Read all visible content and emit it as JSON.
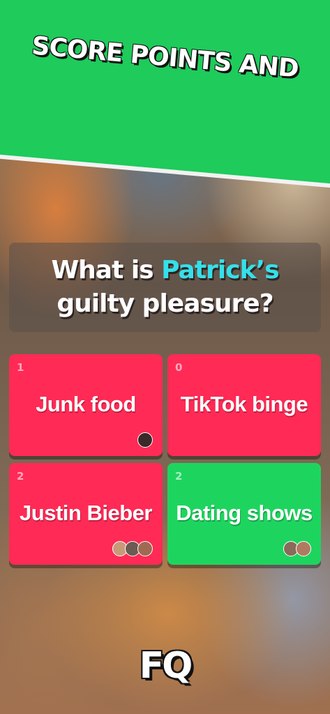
{
  "banner": {
    "headline": "SCORE POINTS AND"
  },
  "question": {
    "prefix": "What is ",
    "name": "Patrick’s",
    "suffix": "guilty pleasure?"
  },
  "answers": [
    {
      "count": "1",
      "label": "Junk food",
      "color": "#ff2a55",
      "avatars": [
        "#3a2a2a"
      ]
    },
    {
      "count": "0",
      "label": "TikTok binge",
      "color": "#ff2a55",
      "avatars": []
    },
    {
      "count": "2",
      "label": "Justin Bieber",
      "color": "#ff2a55",
      "avatars": [
        "#c89a78",
        "#6b5b53",
        "#a06a52"
      ]
    },
    {
      "count": "2",
      "label": "Dating shows",
      "color": "#1dd55e",
      "avatars": [
        "#8a6a5a",
        "#b07a60"
      ]
    }
  ],
  "logo": {
    "text": "FQ"
  },
  "colors": {
    "banner": "#1ecb5b",
    "accent_name": "#34e0ea",
    "wrong": "#ff2a55",
    "correct": "#1dd55e"
  }
}
